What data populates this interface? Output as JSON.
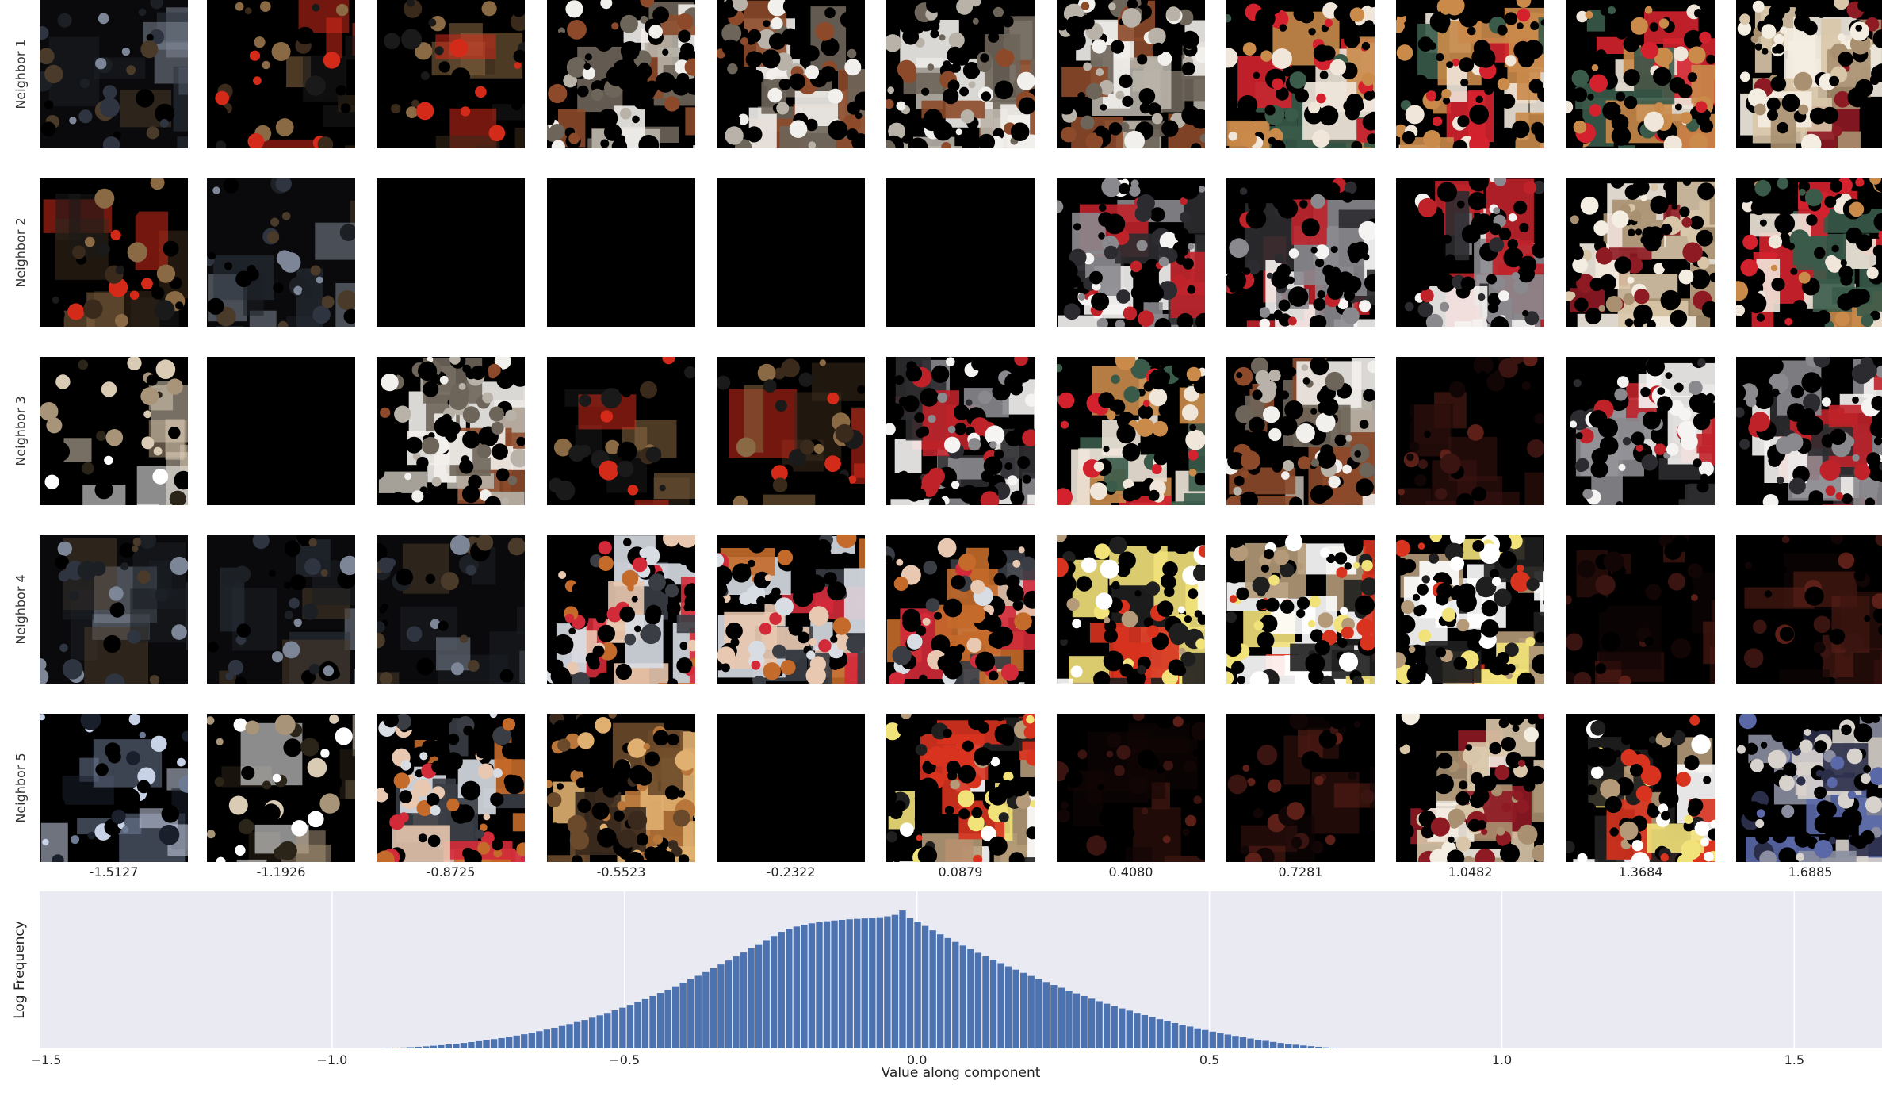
{
  "row_labels": [
    "Neighbor 1",
    "Neighbor 2",
    "Neighbor 3",
    "Neighbor 4",
    "Neighbor 5"
  ],
  "column_values": [
    "-1.5127",
    "-1.1926",
    "-0.8725",
    "-0.5523",
    "-0.2322",
    "0.0879",
    "0.4080",
    "0.7281",
    "1.0482",
    "1.3684",
    "1.6885"
  ],
  "grid_tiles": [
    [
      "dark-scene",
      "dark-eyes",
      "dark-eyes",
      "spaniel",
      "spaniel",
      "spaniel",
      "spaniel",
      "terrier-sign",
      "terrier-sign",
      "terrier-sign",
      "red-speckle"
    ],
    [
      "dark-eyes",
      "dark-scene",
      "black",
      "black",
      "black",
      "black",
      "poodles",
      "poodles",
      "poodles",
      "red-speckle",
      "terrier-sign"
    ],
    [
      "dark-cross",
      "black",
      "spaniel",
      "dark-eyes",
      "dark-eyes",
      "poodles",
      "terrier-sign",
      "spaniel",
      "dark-faint",
      "poodles",
      "poodles"
    ],
    [
      "dark-scene",
      "dark-scene",
      "dark-scene",
      "people",
      "people",
      "people",
      "toy-bag",
      "toy-bag",
      "toy-bag",
      "dark-faint",
      "dark-faint"
    ],
    [
      "dark-dots",
      "dark-cross",
      "people",
      "cat",
      "black",
      "toy-bag",
      "dark-faint",
      "dark-faint",
      "red-speckle",
      "toy-bag",
      "dots-blue"
    ]
  ],
  "tile_palettes": {
    "black": [
      "#000000"
    ],
    "dark-scene": [
      "#0a0a0c",
      "#1c1f24",
      "#2e3440",
      "#4a3a2a",
      "#7d8696"
    ],
    "dark-eyes": [
      "#000000",
      "#3a2a1c",
      "#8a6a44",
      "#d42a1a",
      "#1a1a1a"
    ],
    "dark-cross": [
      "#000000",
      "#2b2418",
      "#a89478",
      "#d9cbb4",
      "#ffffff"
    ],
    "dark-dots": [
      "#000000",
      "#1a1f2c",
      "#c8d2e6",
      "#6d7a94"
    ],
    "dark-faint": [
      "#000000",
      "#120505",
      "#3a1410",
      "#5c2018"
    ],
    "spaniel": [
      "#000000",
      "#8c4a2a",
      "#f2f0ec",
      "#6e655a",
      "#b8b2a8"
    ],
    "terrier-sign": [
      "#000000",
      "#c98a4a",
      "#f0e6da",
      "#d3222e",
      "#3a5b4a"
    ],
    "red-speckle": [
      "#000000",
      "#8e1a24",
      "#d9c6a8",
      "#a89070",
      "#f4ede2"
    ],
    "poodles": [
      "#000000",
      "#f6f4f2",
      "#2c2c30",
      "#c0222a",
      "#8a8a8e"
    ],
    "people": [
      "#000000",
      "#d8dde4",
      "#3a3d44",
      "#d32a3a",
      "#e8c8b0",
      "#c46a2a"
    ],
    "toy-bag": [
      "#000000",
      "#b49a78",
      "#d8331f",
      "#1f1f1f",
      "#f2e27a",
      "#ffffff"
    ],
    "cat": [
      "#000000",
      "#b8763a",
      "#6a4a2a",
      "#e0b070",
      "#3a2a1e"
    ],
    "dots-blue": [
      "#000000",
      "#d8d2cc",
      "#5a68a8",
      "#2a2e48",
      "#8a8ea0"
    ]
  },
  "chart_data": {
    "type": "bar",
    "xlabel": "Value along component",
    "ylabel": "Log Frequency",
    "xlim": [
      -1.5,
      1.65
    ],
    "x_ticks": [
      -1.5,
      -1.0,
      -0.5,
      0.0,
      0.5,
      1.0,
      1.5
    ],
    "x_tick_labels": [
      "−1.5",
      "−1.0",
      "−0.5",
      "0.0",
      "0.5",
      "1.0",
      "1.5"
    ],
    "grid": true,
    "bin_range": [
      -0.91,
      0.72
    ],
    "bin_count": 126,
    "bin_peak_at": -0.065,
    "values": [
      0.002,
      0.004,
      0.006,
      0.008,
      0.011,
      0.014,
      0.018,
      0.022,
      0.027,
      0.032,
      0.037,
      0.043,
      0.049,
      0.056,
      0.063,
      0.07,
      0.078,
      0.087,
      0.096,
      0.106,
      0.117,
      0.128,
      0.14,
      0.152,
      0.165,
      0.179,
      0.193,
      0.208,
      0.224,
      0.241,
      0.258,
      0.276,
      0.295,
      0.314,
      0.334,
      0.355,
      0.376,
      0.398,
      0.421,
      0.444,
      0.468,
      0.492,
      0.517,
      0.543,
      0.569,
      0.596,
      0.623,
      0.65,
      0.678,
      0.706,
      0.734,
      0.762,
      0.79,
      0.81,
      0.826,
      0.838,
      0.848,
      0.856,
      0.862,
      0.867,
      0.871,
      0.875,
      0.878,
      0.881,
      0.884,
      0.889,
      0.895,
      0.905,
      0.935,
      0.882,
      0.86,
      0.83,
      0.8,
      0.773,
      0.748,
      0.722,
      0.697,
      0.672,
      0.648,
      0.624,
      0.601,
      0.578,
      0.556,
      0.534,
      0.512,
      0.491,
      0.47,
      0.45,
      0.43,
      0.411,
      0.392,
      0.373,
      0.355,
      0.337,
      0.32,
      0.303,
      0.287,
      0.271,
      0.256,
      0.241,
      0.226,
      0.212,
      0.198,
      0.185,
      0.172,
      0.16,
      0.148,
      0.136,
      0.125,
      0.114,
      0.104,
      0.094,
      0.085,
      0.076,
      0.067,
      0.059,
      0.051,
      0.044,
      0.037,
      0.031,
      0.025,
      0.02,
      0.015,
      0.011,
      0.007,
      0.004
    ]
  }
}
